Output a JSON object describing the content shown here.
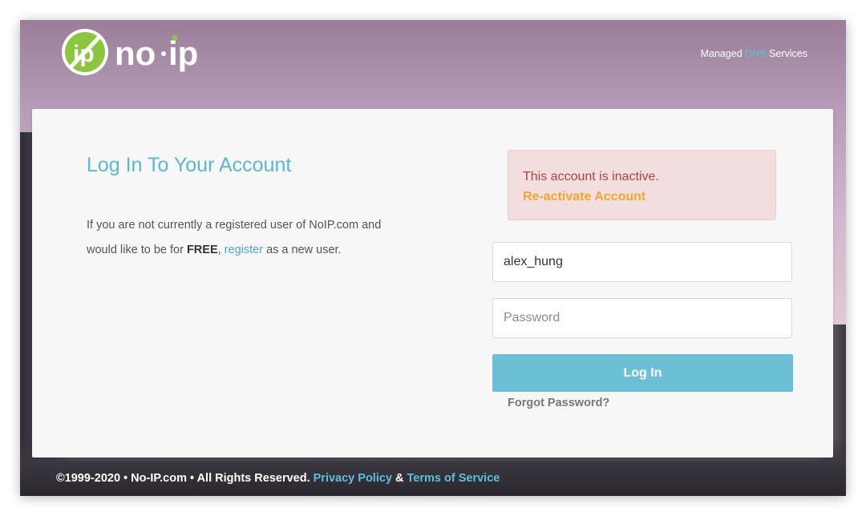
{
  "header": {
    "brand_text": "no·ip",
    "tagline_pre": "Managed",
    "tagline_highlight": "DNS",
    "tagline_post": "Services",
    "accent_color": "#5bc0de",
    "logo_green": "#8cc63f"
  },
  "login": {
    "title": "Log In To Your Account",
    "intro_line1": "If you are not currently a registered user of NoIP.com and",
    "intro_line2_pre": "would like to be for",
    "intro_free": "FREE",
    "intro_comma": ",",
    "intro_register": "register",
    "intro_post": "as a new user.",
    "alert_message": "This account is inactive.",
    "alert_link": "Re-activate Account",
    "username_value": "alex_hung",
    "password_placeholder": "Password",
    "login_button": "Log In",
    "forgot_password": "Forgot Password?"
  },
  "footer": {
    "copyright": "©1999-2020 • No-IP.com • All Rights Reserved.",
    "privacy": "Privacy Policy",
    "amp": "&",
    "terms": "Terms of Service"
  }
}
